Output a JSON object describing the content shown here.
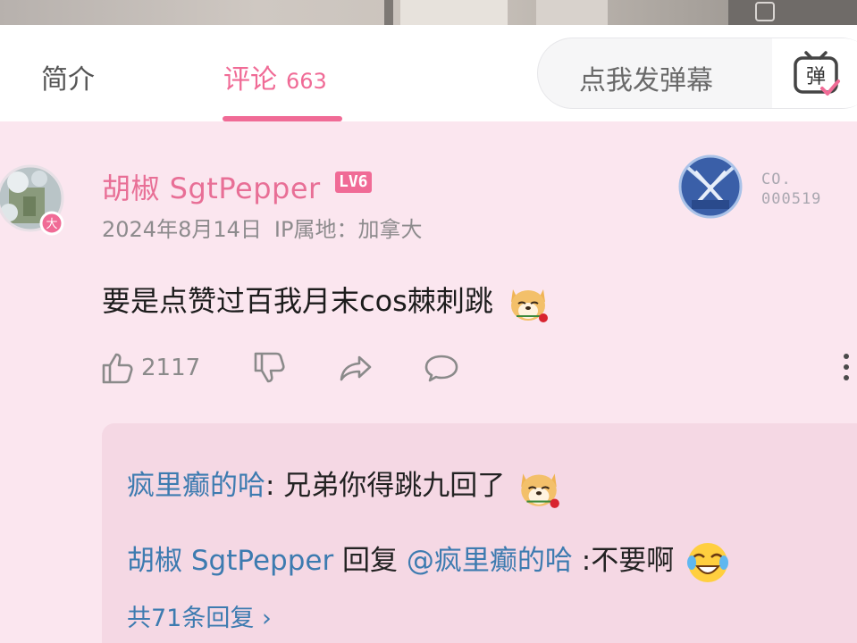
{
  "tabs": {
    "intro_label": "简介",
    "comments_label": "评论",
    "comments_count": "663"
  },
  "danmaku": {
    "placeholder": "点我发弹幕",
    "button_glyph": "弹"
  },
  "comment": {
    "username": "胡椒 SgtPepper",
    "level": "LV6",
    "avatar_badge": "大",
    "date": "2024年8月14日",
    "ip": "IP属地：加拿大",
    "fan_label": "CO.",
    "fan_number": "000519",
    "text": "要是点赞过百我月末cos棘刺跳",
    "likes": "2117"
  },
  "replies": [
    {
      "author": "疯里癫的哈",
      "text": ": 兄弟你得跳九回了"
    },
    {
      "author": "胡椒 SgtPepper",
      "reply_word": " 回复 ",
      "mention": "@疯里癫的哈",
      "text": " :不要啊"
    }
  ],
  "more_replies": "共71条回复 ›",
  "icons": [
    "danmaku-icon",
    "like-icon",
    "dislike-icon",
    "share-icon",
    "reply-icon",
    "more-icon",
    "dog-rose-emoji",
    "crying-laugh-emoji"
  ],
  "colors": {
    "accent": "#f06b96",
    "link": "#3d7bb0",
    "background": "#fbe6ef",
    "reply_bg": "#f5d8e4"
  }
}
